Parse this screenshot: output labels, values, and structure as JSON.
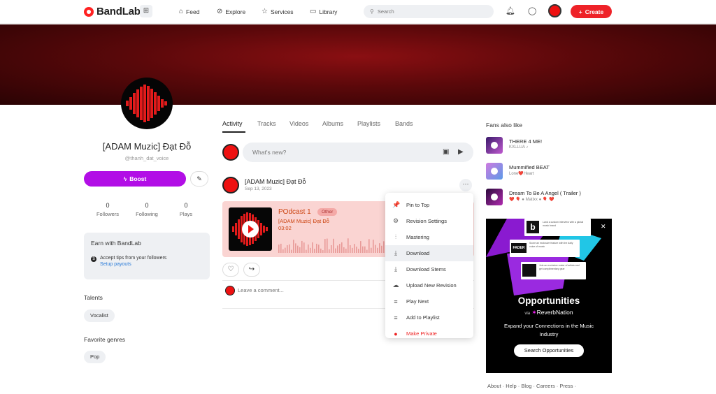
{
  "nav": {
    "logo_text": "BandLab",
    "links": [
      {
        "label": "Feed",
        "icon": "home-icon"
      },
      {
        "label": "Explore",
        "icon": "compass-icon"
      },
      {
        "label": "Services",
        "icon": "star-icon"
      },
      {
        "label": "Library",
        "icon": "library-icon"
      }
    ],
    "search_placeholder": "Search",
    "create_label": "Create"
  },
  "profile": {
    "name": "[ADAM Muzic] Đạt Đỗ",
    "handle": "@thanh_dat_voice",
    "boost_label": "Boost",
    "stats": [
      {
        "num": "0",
        "label": "Followers"
      },
      {
        "num": "0",
        "label": "Following"
      },
      {
        "num": "0",
        "label": "Plays"
      }
    ],
    "earn": {
      "title": "Earn with BandLab",
      "text": "Accept tips from your followers",
      "link": "Setup payouts"
    },
    "talents_heading": "Talents",
    "talents": [
      "Vocalist"
    ],
    "genres_heading": "Favorite genres",
    "genres": [
      "Pop"
    ]
  },
  "tabs": [
    "Activity",
    "Tracks",
    "Videos",
    "Albums",
    "Playlists",
    "Bands"
  ],
  "composer_placeholder": "What's new?",
  "post": {
    "author": "[ADAM Muzic] Đạt Đỗ",
    "date": "Sep 13, 2023",
    "more": "···",
    "track": {
      "title": "POdcast 1",
      "tag": "Other",
      "artist": "[ADAM Muzic] Đạt Đỗ",
      "duration": "03:02"
    },
    "comment_placeholder": "Leave a comment..."
  },
  "menu": {
    "items": [
      {
        "label": "Pin to Top",
        "icon": "pin-icon",
        "glyph": "📌"
      },
      {
        "label": "Revision Settings",
        "icon": "gear-icon",
        "glyph": "⚙"
      },
      {
        "label": "Mastering",
        "icon": "sliders-icon",
        "glyph": "⫶"
      },
      {
        "label": "Download",
        "icon": "download-icon",
        "glyph": "⤓"
      },
      {
        "label": "Download Stems",
        "icon": "download-stems-icon",
        "glyph": "⤓"
      },
      {
        "label": "Upload New Revision",
        "icon": "cloud-upload-icon",
        "glyph": "☁"
      },
      {
        "label": "Play Next",
        "icon": "queue-icon",
        "glyph": "≡"
      },
      {
        "label": "Add to Playlist",
        "icon": "playlist-add-icon",
        "glyph": "≡"
      },
      {
        "label": "Make Private",
        "icon": "globe-icon",
        "glyph": "●"
      }
    ],
    "highlighted_index": 3
  },
  "fans": {
    "heading": "Fans also like",
    "items": [
      {
        "title": "THERE 4 ME!",
        "sub": "KXLLUA ♪",
        "color": "#6a3aa8"
      },
      {
        "title": "Mummified BEAT",
        "sub": "Lone❤️Heart",
        "color": "#b04ac0"
      },
      {
        "title": "Dream To Be A Angel ( Trailer )",
        "sub": "❤️ 🎈 ● Matixx ● 🎈 ❤️",
        "color": "#7a1a8a"
      }
    ]
  },
  "ad": {
    "heading": "Opportunities",
    "via": "via",
    "brand": "ReverbNation",
    "desc": "Expand your Connections in the Music Industry",
    "button": "Search Opportunities",
    "card1_text": "Land a custom interview with a global music brand",
    "card2_logo": "FADER",
    "card2_text": "Score an exclusive feature with the daily voice of music",
    "card3_text": "Join an exclusive roster of artists and get complimentary gear"
  },
  "footer": "About · Help · Blog · Careers · Press ·",
  "colors": {
    "accent_red": "#ee2228",
    "boost_purple": "#b20ee6",
    "banner": "#5a080a",
    "track_card": "#fad4d2"
  }
}
